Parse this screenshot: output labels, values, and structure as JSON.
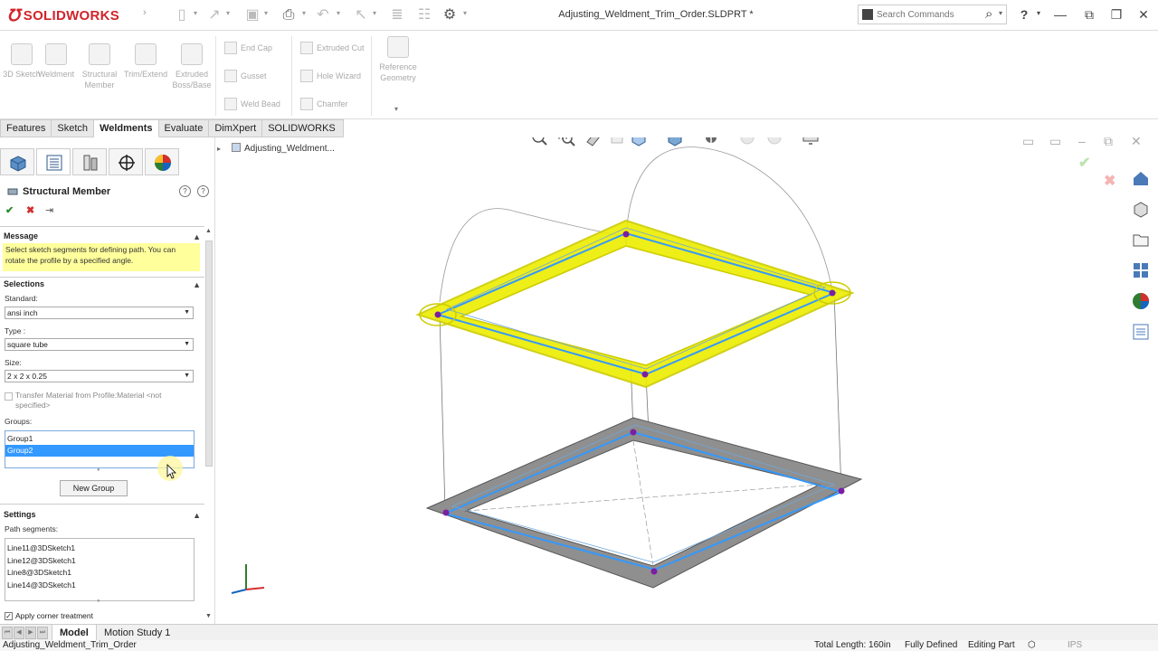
{
  "app": {
    "logo_brand": "SOLIDWORKS",
    "doc_title": "Adjusting_Weldment_Trim_Order.SLDPRT *",
    "search_placeholder": "Search Commands"
  },
  "command_manager": {
    "large": [
      {
        "label": "3D Sketch"
      },
      {
        "label": "Weldment"
      },
      {
        "label": "Structural Member"
      },
      {
        "label": "Trim/Extend"
      },
      {
        "label": "Extruded Boss/Base"
      }
    ],
    "small_col1": [
      {
        "label": "End Cap"
      },
      {
        "label": "Gusset"
      },
      {
        "label": "Weld Bead"
      }
    ],
    "small_col2": [
      {
        "label": "Extruded Cut"
      },
      {
        "label": "Hole Wizard"
      },
      {
        "label": "Chamfer"
      }
    ],
    "reference_geometry": "Reference Geometry"
  },
  "tabs": [
    {
      "label": "Features",
      "active": false
    },
    {
      "label": "Sketch",
      "active": false
    },
    {
      "label": "Weldments",
      "active": true
    },
    {
      "label": "Evaluate",
      "active": false
    },
    {
      "label": "DimXpert",
      "active": false
    },
    {
      "label": "SOLIDWORKS Add-Ins",
      "active": false
    }
  ],
  "property_manager": {
    "title": "Structural Member",
    "message_header": "Message",
    "message_text": "Select sketch segments for defining path. You can rotate the profile by a specified angle.",
    "selections_header": "Selections",
    "standard_label": "Standard:",
    "standard_value": "ansi inch",
    "type_label": "Type :",
    "type_value": "square tube",
    "size_label": "Size:",
    "size_value": "2 x 2 x 0.25",
    "transfer_label": "Transfer Material from Profile:Material <not specified>",
    "groups_label": "Groups:",
    "groups": [
      "Group1",
      "Group2"
    ],
    "selected_group": "Group2",
    "new_group_label": "New Group",
    "settings_header": "Settings",
    "path_segments_label": "Path segments:",
    "path_segments": [
      "Line11@3DSketch1",
      "Line12@3DSketch1",
      "Line8@3DSketch1",
      "Line14@3DSketch1"
    ],
    "corner_treatment_label": "Apply corner treatment",
    "corner_treatment_checked": true
  },
  "viewport": {
    "tree_root": "Adjusting_Weldment..."
  },
  "bottom_tabs": [
    {
      "label": "Model",
      "active": true
    },
    {
      "label": "Motion Study 1",
      "active": false
    }
  ],
  "status_bar": {
    "doc_name": "Adjusting_Weldment_Trim_Order",
    "total_length": "Total Length: 160in",
    "definition": "Fully Defined",
    "mode": "Editing Part",
    "units": "IPS"
  },
  "colors": {
    "brand_red": "#d2232a",
    "highlight_yellow": "#f0f000",
    "path_blue": "#3399ff",
    "member_gray": "#8c8c8c",
    "message_yellow": "#ffff9c"
  }
}
